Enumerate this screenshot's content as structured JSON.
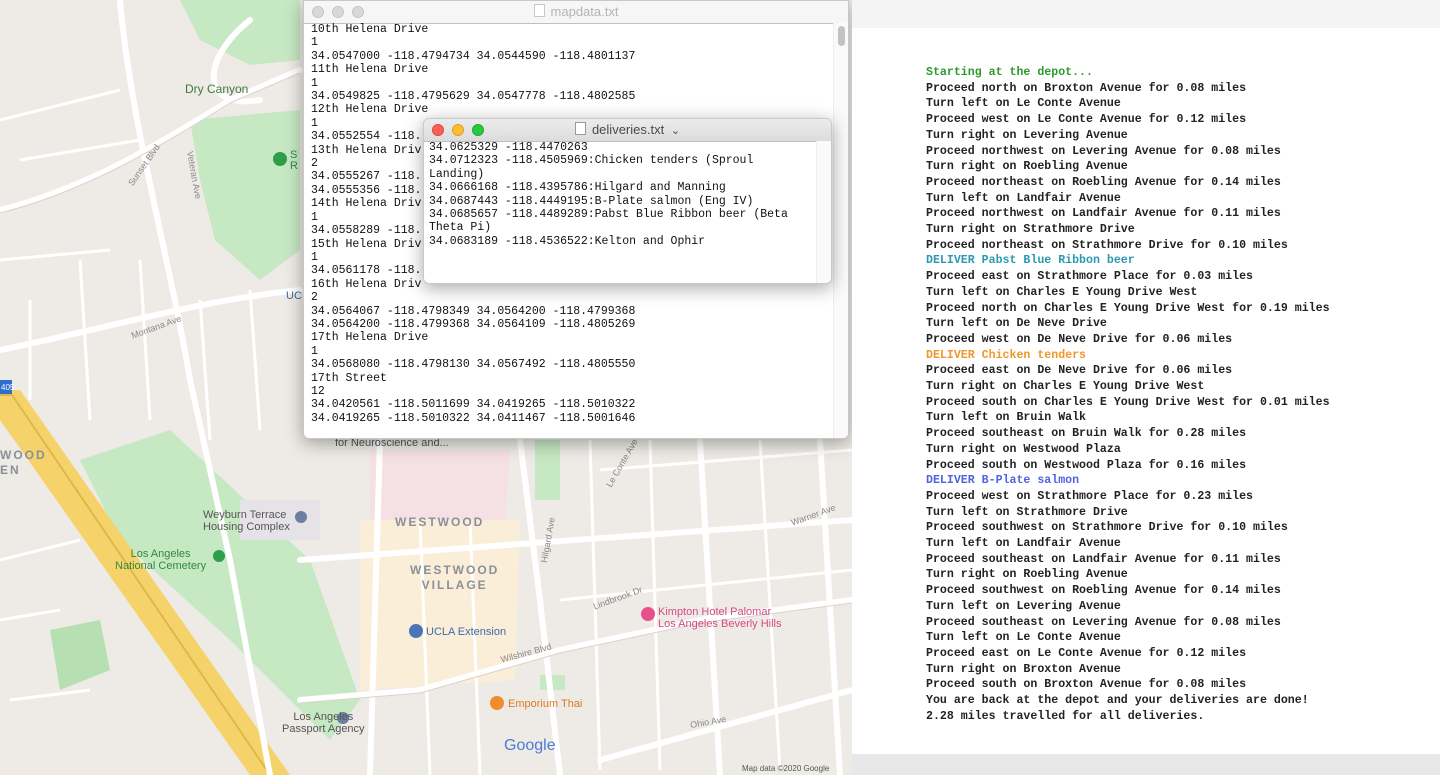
{
  "map": {
    "labels": {
      "dry_canyon": "Dry Canyon",
      "sunset_blvd": "Sunset Blvd",
      "veteran_ave": "Veteran Ave",
      "montana_ave": "Montana Ave",
      "westwood_left": "WOOD\nEN",
      "westwood": "WESTWOOD",
      "westwood_village": "WESTWOOD\nVILLAGE",
      "wyburn": "Weyburn Terrace\nHousing Complex",
      "la_cemetery": "Los Angeles\nNational Cemetery",
      "ucla_ext": "UCLA Extension",
      "kimpton": "Kimpton Hotel Palomar\nLos Angeles Beverly Hills",
      "emporium": "Emporium Thai",
      "passport": "Los Angeles\nPassport Agency",
      "neuroscience": "for Neuroscience and...",
      "wilshire": "Wilshire Blvd",
      "google": "Google",
      "map_data": "Map data ©2020 Google",
      "hilgard": "Hilgard Ave",
      "ohio": "Ohio Ave",
      "lindbrook": "Lindbrook Dr",
      "le_conte": "Le Conte Ave",
      "warner": "Warner Ave",
      "route": "405",
      "ucla_partial": "UC",
      "s_partial": "S\nR"
    },
    "colors": {
      "park": "#c6e8c3",
      "road": "#ffffff",
      "freeway": "#f6d36a",
      "campus": "#f3e5d8",
      "water": "#aadaff"
    }
  },
  "mapdata_window": {
    "title": "mapdata.txt",
    "lines": [
      "10th Helena Drive",
      "1",
      "34.0547000 -118.4794734 34.0544590 -118.4801137",
      "11th Helena Drive",
      "1",
      "34.0549825 -118.4795629 34.0547778 -118.4802585",
      "12th Helena Drive",
      "1",
      "34.0552554 -118.",
      "13th Helena Driv",
      "2",
      "34.0555267 -118.",
      "34.0555356 -118.",
      "14th Helena Driv",
      "1",
      "34.0558289 -118.",
      "15th Helena Driv",
      "1",
      "34.0561178 -118.",
      "16th Helena Driv",
      "2",
      "34.0564067 -118.4798349 34.0564200 -118.4799368",
      "34.0564200 -118.4799368 34.0564109 -118.4805269",
      "17th Helena Drive",
      "1",
      "34.0568080 -118.4798130 34.0567492 -118.4805550",
      "17th Street",
      "12",
      "34.0420561 -118.5011699 34.0419265 -118.5010322",
      "34.0419265 -118.5010322 34.0411467 -118.5001646"
    ]
  },
  "deliveries_window": {
    "title": "deliveries.txt",
    "chevron": "⌄",
    "lines": [
      "34.0625329 -118.4470263",
      "34.0712323 -118.4505969:Chicken tenders (Sproul",
      "Landing)",
      "34.0666168 -118.4395786:Hilgard and Manning",
      "34.0687443 -118.4449195:B-Plate salmon (Eng IV)",
      "34.0685657 -118.4489289:Pabst Blue Ribbon beer (Beta",
      "Theta Pi)",
      "34.0683189 -118.4536522:Kelton and Ophir"
    ]
  },
  "output": {
    "colors": {
      "default": "#222222",
      "green": "#2e9a2e",
      "teal": "#2b9ab0",
      "orange": "#f0962a",
      "blue": "#4f63e0"
    },
    "lines": [
      {
        "text": "Starting at the depot...",
        "color": "green"
      },
      {
        "text": "Proceed north on Broxton Avenue for 0.08 miles",
        "color": "default"
      },
      {
        "text": "Turn left on Le Conte Avenue",
        "color": "default"
      },
      {
        "text": "Proceed west on Le Conte Avenue for 0.12 miles",
        "color": "default"
      },
      {
        "text": "Turn right on Levering Avenue",
        "color": "default"
      },
      {
        "text": "Proceed northwest on Levering Avenue for 0.08 miles",
        "color": "default"
      },
      {
        "text": "Turn right on Roebling Avenue",
        "color": "default"
      },
      {
        "text": "Proceed northeast on Roebling Avenue for 0.14 miles",
        "color": "default"
      },
      {
        "text": "Turn left on Landfair Avenue",
        "color": "default"
      },
      {
        "text": "Proceed northwest on Landfair Avenue for 0.11 miles",
        "color": "default"
      },
      {
        "text": "Turn right on Strathmore Drive",
        "color": "default"
      },
      {
        "text": "Proceed northeast on Strathmore Drive for 0.10 miles",
        "color": "default"
      },
      {
        "text": "DELIVER Pabst Blue Ribbon beer",
        "color": "teal"
      },
      {
        "text": "Proceed east on Strathmore Place for 0.03 miles",
        "color": "default"
      },
      {
        "text": "Turn left on Charles E Young Drive West",
        "color": "default"
      },
      {
        "text": "Proceed north on Charles E Young Drive West for 0.19 miles",
        "color": "default"
      },
      {
        "text": "Turn left on De Neve Drive",
        "color": "default"
      },
      {
        "text": "Proceed west on De Neve Drive for 0.06 miles",
        "color": "default"
      },
      {
        "text": "DELIVER Chicken tenders",
        "color": "orange"
      },
      {
        "text": "Proceed east on De Neve Drive for 0.06 miles",
        "color": "default"
      },
      {
        "text": "Turn right on Charles E Young Drive West",
        "color": "default"
      },
      {
        "text": "Proceed south on Charles E Young Drive West for 0.01 miles",
        "color": "default"
      },
      {
        "text": "Turn left on Bruin Walk",
        "color": "default"
      },
      {
        "text": "Proceed southeast on Bruin Walk for 0.28 miles",
        "color": "default"
      },
      {
        "text": "Turn right on Westwood Plaza",
        "color": "default"
      },
      {
        "text": "Proceed south on Westwood Plaza for 0.16 miles",
        "color": "default"
      },
      {
        "text": "DELIVER B-Plate salmon",
        "color": "blue"
      },
      {
        "text": "Proceed west on Strathmore Place for 0.23 miles",
        "color": "default"
      },
      {
        "text": "Turn left on Strathmore Drive",
        "color": "default"
      },
      {
        "text": "Proceed southwest on Strathmore Drive for 0.10 miles",
        "color": "default"
      },
      {
        "text": "Turn left on Landfair Avenue",
        "color": "default"
      },
      {
        "text": "Proceed southeast on Landfair Avenue for 0.11 miles",
        "color": "default"
      },
      {
        "text": "Turn right on Roebling Avenue",
        "color": "default"
      },
      {
        "text": "Proceed southwest on Roebling Avenue for 0.14 miles",
        "color": "default"
      },
      {
        "text": "Turn left on Levering Avenue",
        "color": "default"
      },
      {
        "text": "Proceed southeast on Levering Avenue for 0.08 miles",
        "color": "default"
      },
      {
        "text": "Turn left on Le Conte Avenue",
        "color": "default"
      },
      {
        "text": "Proceed east on Le Conte Avenue for 0.12 miles",
        "color": "default"
      },
      {
        "text": "Turn right on Broxton Avenue",
        "color": "default"
      },
      {
        "text": "Proceed south on Broxton Avenue for 0.08 miles",
        "color": "default"
      },
      {
        "text": "You are back at the depot and your deliveries are done!",
        "color": "default"
      },
      {
        "text": "2.28 miles travelled for all deliveries.",
        "color": "default"
      }
    ]
  }
}
